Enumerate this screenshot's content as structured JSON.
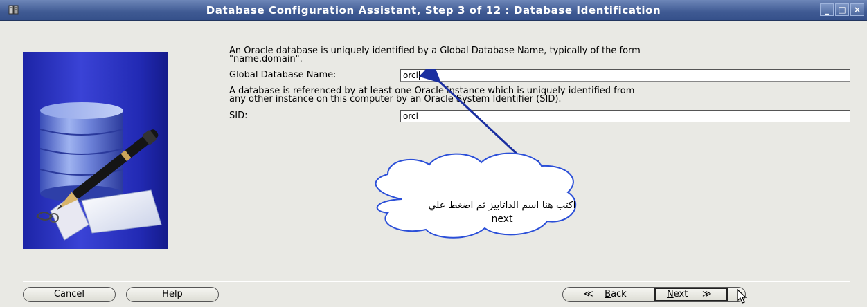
{
  "window": {
    "title": "Database Configuration Assistant, Step 3 of 12 : Database Identification",
    "controls": [
      "_",
      "□",
      "×"
    ]
  },
  "content": {
    "intro_line1": "An Oracle database is uniquely identified by a Global Database Name, typically of the form",
    "intro_line2": "\"name.domain\".",
    "global_db_label": "Global Database Name:",
    "global_db_value": "orcl",
    "sid_desc_line1": "A database is referenced by at least one Oracle instance which is uniquely identified from",
    "sid_desc_line2": "any other instance on this computer by an Oracle System Identifier (SID).",
    "sid_label": "SID:",
    "sid_value": "orcl"
  },
  "annotation": {
    "callout_line1": "اكتب هنا اسم الداتابيز ثم اضغط علي",
    "callout_line2": "next",
    "arrow_color": "#1a2fa0"
  },
  "buttons": {
    "cancel": "Cancel",
    "help": "Help",
    "back_mnemonic": "B",
    "back_rest": "ack",
    "next_mnemonic": "N",
    "next_rest": "ext",
    "back_arrow": "≪",
    "next_arrow": "≫"
  },
  "icons": {
    "side_illustration": "database-cylinder-with-pen-icon",
    "cursor": "mouse-pointer-icon"
  },
  "colors": {
    "titlebar": "#3f5a93",
    "side_panel": "#2a32c0",
    "background": "#e9e9e4"
  }
}
